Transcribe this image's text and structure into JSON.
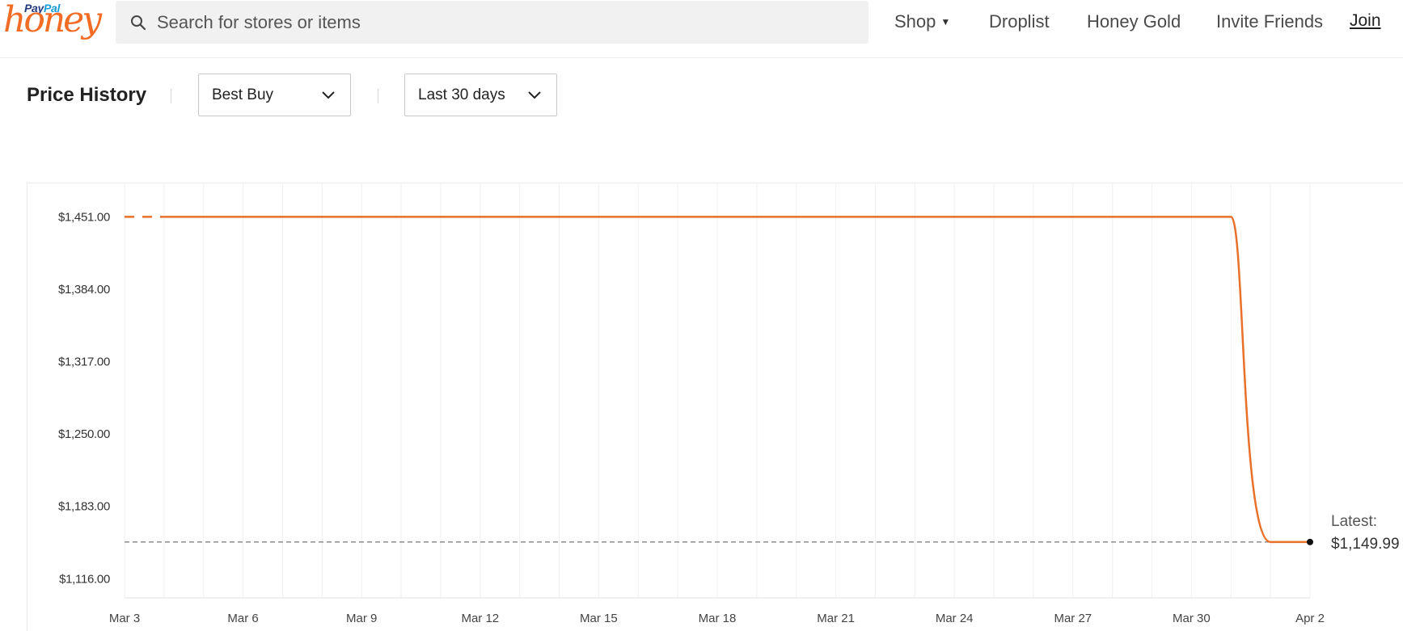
{
  "header": {
    "logo": {
      "brand_pay": "Pay",
      "brand_pal": "Pal",
      "brand_honey": "honey"
    },
    "search": {
      "placeholder": "Search for stores or items",
      "icon": "search-icon"
    },
    "nav": {
      "shop": "Shop",
      "droplist": "Droplist",
      "honey_gold": "Honey Gold",
      "invite_friends": "Invite Friends",
      "join": "Join"
    }
  },
  "controls": {
    "title": "Price History",
    "store_select": {
      "value": "Best Buy",
      "icon": "chevron-down-icon"
    },
    "range_select": {
      "value": "Last 30 days",
      "icon": "chevron-down-icon"
    }
  },
  "latest": {
    "label": "Latest:",
    "value": "$1,149.99"
  },
  "colors": {
    "accent": "#f26c25",
    "line": "#e8702a",
    "grid": "#f0f0f0"
  },
  "chart_data": {
    "type": "line",
    "title": "",
    "xlabel": "",
    "ylabel": "",
    "ylim": [
      1105,
      1461
    ],
    "y_ticks": [
      {
        "value": 1451,
        "label": "$1,451.00"
      },
      {
        "value": 1384,
        "label": "$1,384.00"
      },
      {
        "value": 1317,
        "label": "$1,317.00"
      },
      {
        "value": 1250,
        "label": "$1,250.00"
      },
      {
        "value": 1183,
        "label": "$1,183.00"
      },
      {
        "value": 1116,
        "label": "$1,116.00"
      }
    ],
    "x_ticks": [
      {
        "day": 0,
        "label": "Mar 3"
      },
      {
        "day": 3,
        "label": "Mar 6"
      },
      {
        "day": 6,
        "label": "Mar 9"
      },
      {
        "day": 9,
        "label": "Mar 12"
      },
      {
        "day": 12,
        "label": "Mar 15"
      },
      {
        "day": 15,
        "label": "Mar 18"
      },
      {
        "day": 18,
        "label": "Mar 21"
      },
      {
        "day": 21,
        "label": "Mar 24"
      },
      {
        "day": 24,
        "label": "Mar 27"
      },
      {
        "day": 27,
        "label": "Mar 30"
      },
      {
        "day": 30,
        "label": "Apr 2"
      }
    ],
    "grid": true,
    "series": [
      {
        "points": [
          {
            "x": "Mar 3",
            "y": 1451.0
          },
          {
            "x": "Mar 31",
            "y": 1451.0
          },
          {
            "x": "Apr 1",
            "y": 1149.99
          },
          {
            "x": "Apr 2",
            "y": 1149.99
          }
        ],
        "dashed_until": "Mar 4"
      }
    ],
    "reference_line": {
      "y": 1149.99
    }
  }
}
